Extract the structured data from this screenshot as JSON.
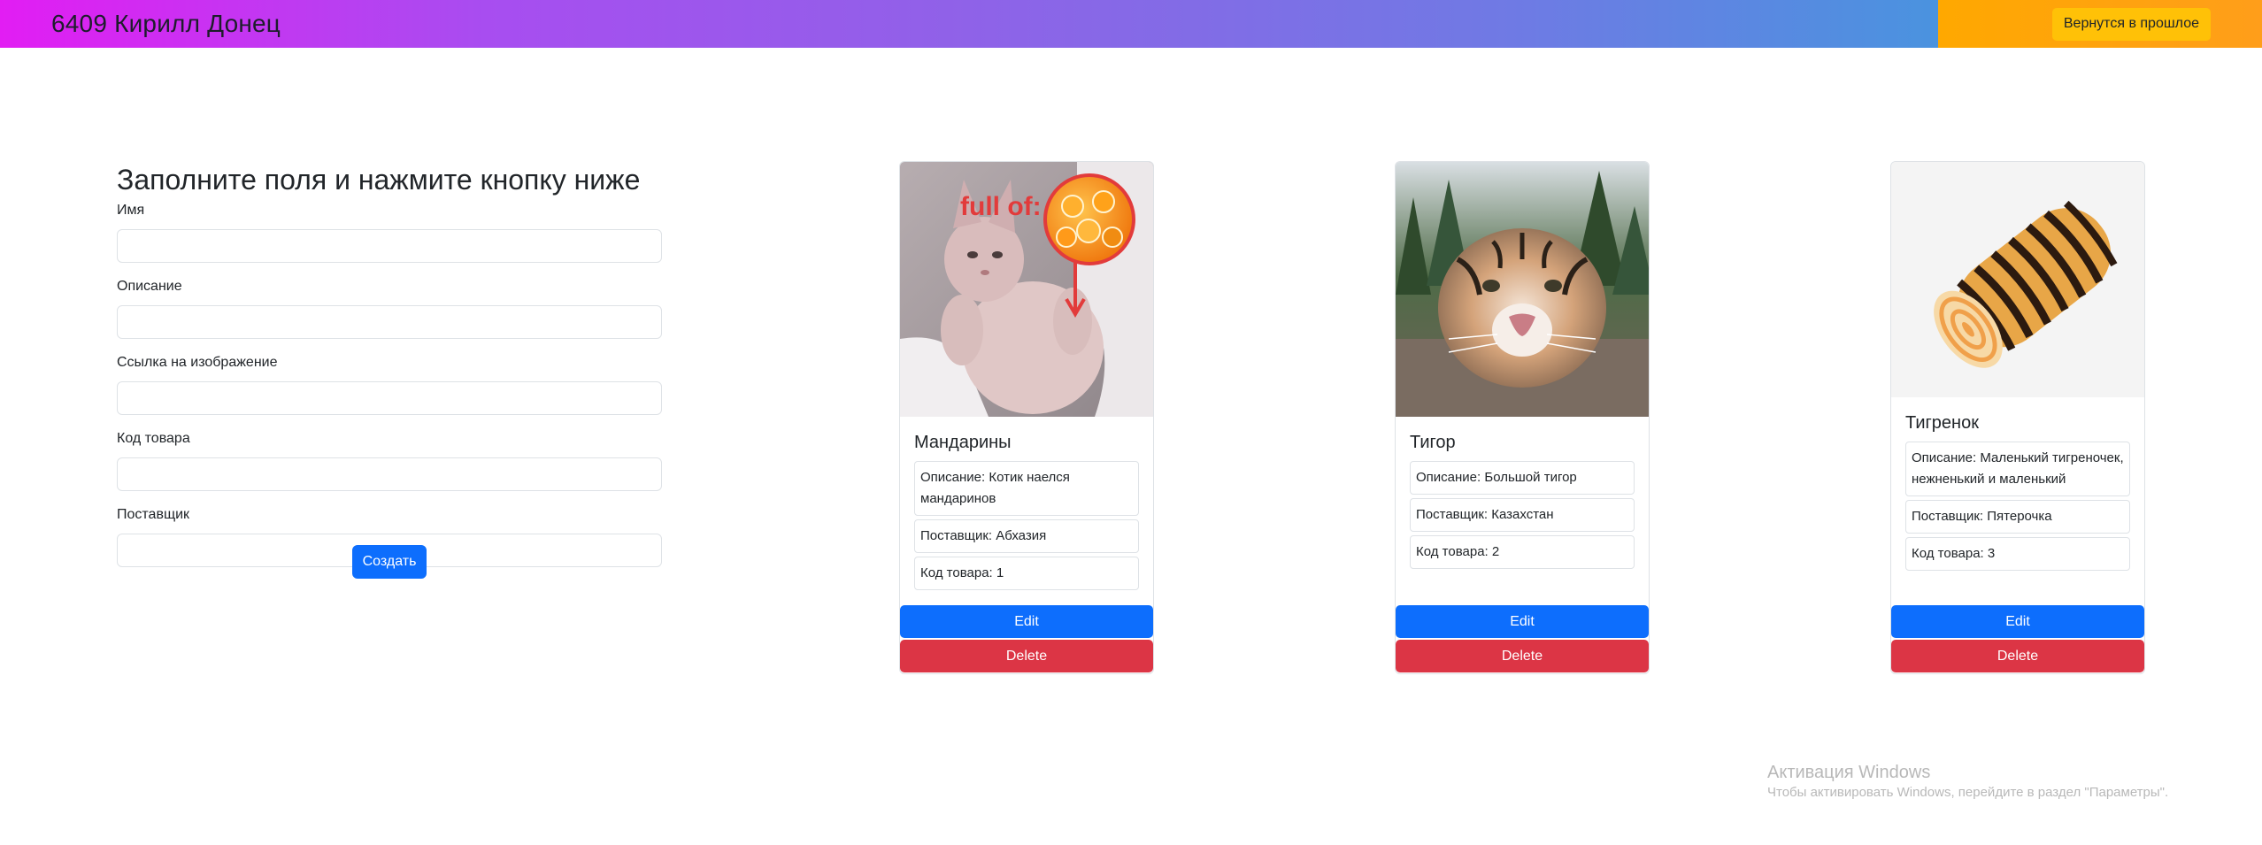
{
  "header": {
    "brand": "6409 Кирилл Донец",
    "back_button": "Вернутся в прошлое",
    "colors": {
      "gradient_start": "#e21df3",
      "gradient_end": "#4a93df",
      "side": "#ffa800"
    }
  },
  "form": {
    "title": "Заполните поля и нажмите кнопку ниже",
    "fields": [
      {
        "label": "Имя",
        "value": "",
        "placeholder": ""
      },
      {
        "label": "Описание",
        "value": "",
        "placeholder": ""
      },
      {
        "label": "Ссылка на изображение",
        "value": "",
        "placeholder": ""
      },
      {
        "label": "Код товара",
        "value": "",
        "placeholder": ""
      },
      {
        "label": "Поставщик",
        "value": "",
        "placeholder": ""
      }
    ],
    "submit_label": "Создать"
  },
  "cards": [
    {
      "title": "Мандарины",
      "image_alt": "hairless cat with tangerines",
      "image_caption": "full of:",
      "description": "Описание: Котик наелся мандаринов",
      "supplier": "Поставщик: Абхазия",
      "code": "Код товара: 1",
      "edit_label": "Edit",
      "delete_label": "Delete"
    },
    {
      "title": "Тигор",
      "image_alt": "tiger face close-up",
      "description": "Описание: Большой тигор",
      "supplier": "Поставщик: Казахстан",
      "code": "Код товара: 2",
      "edit_label": "Edit",
      "delete_label": "Delete"
    },
    {
      "title": "Тигренок",
      "image_alt": "tiger-striped swiss roll cake",
      "description": "Описание: Маленький тигреночек, нежненький и маленький",
      "supplier": "Поставщик: Пятерочка",
      "code": "Код товара: 3",
      "edit_label": "Edit",
      "delete_label": "Delete"
    }
  ],
  "windows_activation": {
    "title": "Активация Windows",
    "subtitle": "Чтобы активировать Windows, перейдите в раздел \"Параметры\"."
  },
  "colors": {
    "primary": "#0d6efd",
    "danger": "#dc3545",
    "warning": "#ffc107"
  }
}
